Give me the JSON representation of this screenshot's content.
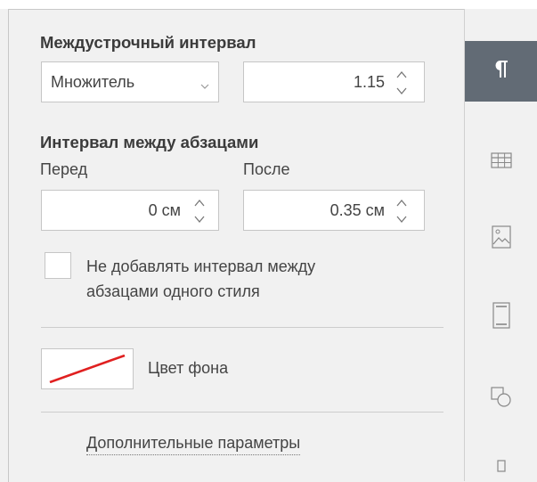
{
  "line_spacing": {
    "title": "Междустрочный интервал",
    "mode": "Множитель",
    "value": "1.15"
  },
  "paragraph_spacing": {
    "title": "Интервал между абзацами",
    "before_label": "Перед",
    "before_value": "0 см",
    "after_label": "После",
    "after_value": "0.35 см"
  },
  "no_spacing_checkbox": {
    "label_line1": "Не добавлять интервал между",
    "label_line2": "абзацами одного стиля",
    "checked": false
  },
  "background": {
    "label": "Цвет фона"
  },
  "advanced_link": "Дополнительные параметры",
  "sidebar": {
    "tabs": [
      {
        "icon": "paragraph-icon",
        "active": true
      },
      {
        "icon": "table-icon",
        "active": false
      },
      {
        "icon": "image-icon",
        "active": false
      },
      {
        "icon": "header-footer-icon",
        "active": false
      },
      {
        "icon": "shape-icon",
        "active": false
      }
    ]
  },
  "colors": {
    "active_tab": "#626b75",
    "no_fill_line": "#e02020"
  }
}
